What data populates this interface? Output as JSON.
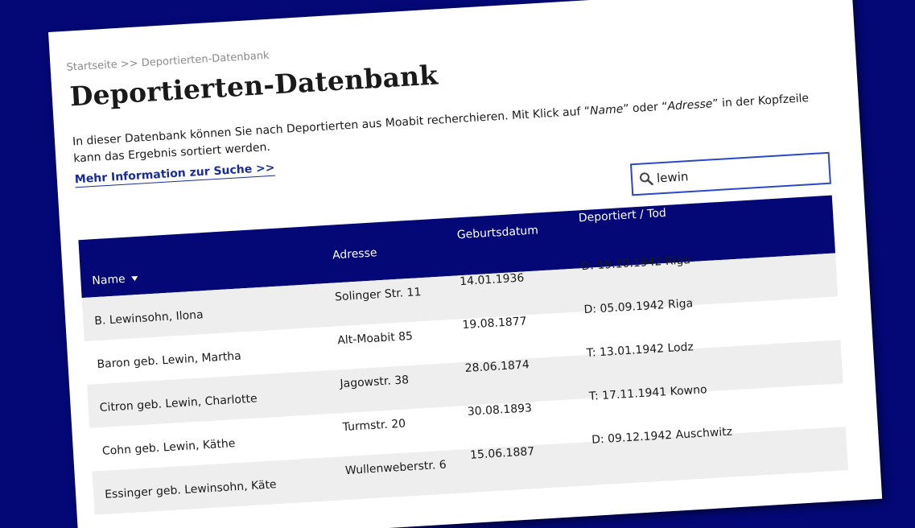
{
  "breadcrumb": {
    "home": "Startseite",
    "separator": ">>",
    "current": "Deportierten-Datenbank"
  },
  "page": {
    "title": "Deportierten-Datenbank",
    "intro_part1": "In dieser Datenbank können Sie nach Deportierten aus Moabit recherchieren. Mit Klick auf “",
    "intro_name": "Name",
    "intro_part2": "” oder “",
    "intro_address": "Adresse",
    "intro_part3": "” in der Kopfzeile kann das Ergebnis sortiert werden.",
    "more_link": "Mehr Information zur Suche >>"
  },
  "search": {
    "value": "lewin",
    "icon": "magnifier-icon"
  },
  "table": {
    "headers": {
      "name": "Name",
      "address": "Adresse",
      "birthdate": "Geburtsdatum",
      "deported": "Deportiert / Tod"
    },
    "rows": [
      {
        "name": "B. Lewinsohn, Ilona",
        "address": "Solinger Str. 11",
        "birthdate": "14.01.1936",
        "deported": "D: 19.10.1942 Riga"
      },
      {
        "name": "Baron geb. Lewin, Martha",
        "address": "Alt-Moabit 85",
        "birthdate": "19.08.1877",
        "deported": "D: 05.09.1942 Riga"
      },
      {
        "name": "Citron geb. Lewin, Charlotte",
        "address": "Jagowstr. 38",
        "birthdate": "28.06.1874",
        "deported": "T: 13.01.1942 Lodz"
      },
      {
        "name": "Cohn geb. Lewin, Käthe",
        "address": "Turmstr. 20",
        "birthdate": "30.08.1893",
        "deported": "T: 17.11.1941 Kowno"
      },
      {
        "name": "Essinger geb. Lewinsohn, Käte",
        "address": "Wullenweberstr. 6",
        "birthdate": "15.06.1887",
        "deported": "D: 09.12.1942 Auschwitz"
      }
    ]
  },
  "colors": {
    "background": "#030876",
    "header_bg": "#030876",
    "link": "#1a2c9a",
    "search_border": "#2a48c8",
    "row_alt": "#eeeeee"
  }
}
